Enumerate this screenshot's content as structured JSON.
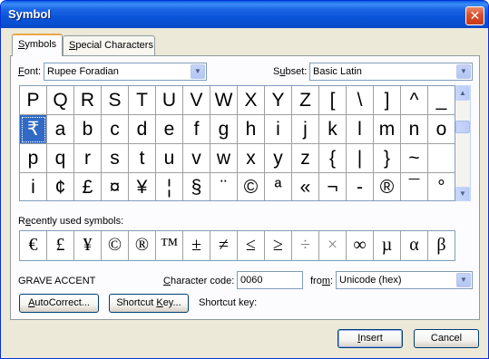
{
  "window": {
    "title": "Symbol",
    "close_glyph": "✕"
  },
  "tabs": [
    {
      "pre": "",
      "u": "S",
      "post": "ymbols",
      "active": true
    },
    {
      "pre": "",
      "u": "S",
      "post": "pecial Characters",
      "active": false
    }
  ],
  "font": {
    "label_u": "F",
    "label_rest": "ont:",
    "value": "Rupee Foradian"
  },
  "subset": {
    "label_pre": "S",
    "label_u": "u",
    "label_rest": "bset:",
    "value": "Basic Latin"
  },
  "symbol_grid": [
    [
      "P",
      "Q",
      "R",
      "S",
      "T",
      "U",
      "V",
      "W",
      "X",
      "Y",
      "Z",
      "[",
      "\\",
      "]",
      "^",
      "_"
    ],
    [
      "₹",
      "a",
      "b",
      "c",
      "d",
      "e",
      "f",
      "g",
      "h",
      "i",
      "j",
      "k",
      "l",
      "m",
      "n",
      "o"
    ],
    [
      "p",
      "q",
      "r",
      "s",
      "t",
      "u",
      "v",
      "w",
      "x",
      "y",
      "z",
      "{",
      "|",
      "}",
      "~",
      ""
    ],
    [
      "i",
      "¢",
      "£",
      "¤",
      "¥",
      "¦",
      "§",
      "¨",
      "©",
      "ª",
      "«",
      "¬",
      "-",
      "®",
      "¯",
      "°"
    ]
  ],
  "selected_cell": {
    "row": 1,
    "col": 0
  },
  "recent": {
    "label": "Recently used symbols:",
    "label_u_index": 1,
    "symbols": [
      "€",
      "£",
      "¥",
      "©",
      "®",
      "™",
      "±",
      "≠",
      "≤",
      "≥",
      "÷",
      "×",
      "∞",
      "µ",
      "α",
      "β"
    ]
  },
  "character_name": "GRAVE ACCENT",
  "char_code": {
    "label_u": "C",
    "label_rest": "haracter code:",
    "value": "0060"
  },
  "from": {
    "label_pre": "fro",
    "label_u": "m",
    "label_rest": ":",
    "value": "Unicode (hex)"
  },
  "buttons": {
    "autocorrect": {
      "u": "A",
      "rest": "utoCorrect..."
    },
    "shortcut_key": {
      "pre": "Shortcut ",
      "u": "K",
      "rest": "ey..."
    },
    "shortcut_key_label": "Shortcut key:",
    "insert": {
      "u": "I",
      "rest": "nsert"
    },
    "cancel": "Cancel"
  },
  "icons": {
    "dropdown": "▼",
    "scroll_up": "▲",
    "scroll_down": "▼"
  },
  "colors": {
    "titlebar": "#0a54d8",
    "selection": "#316ac5",
    "dialog_bg": "#ece9d8",
    "tab_highlight": "#e9a845"
  }
}
